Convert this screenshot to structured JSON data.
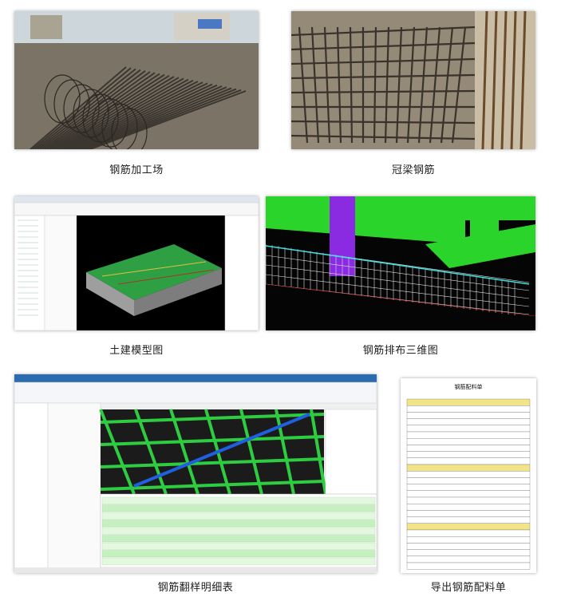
{
  "figures": [
    {
      "caption": "钢筋加工场"
    },
    {
      "caption": "冠梁钢筋"
    },
    {
      "caption": "土建模型图"
    },
    {
      "caption": "钢筋排布三维图"
    },
    {
      "caption": "钢筋翻样明细表"
    },
    {
      "caption": "导出钢筋配料单"
    }
  ],
  "sheet": {
    "title": "钢筋配料单"
  },
  "colors": {
    "model_green": "#2ecc40",
    "model_purple": "#8a2be2",
    "model_dark": "#1a1a1a",
    "sheet_band": "#f3e48a"
  }
}
